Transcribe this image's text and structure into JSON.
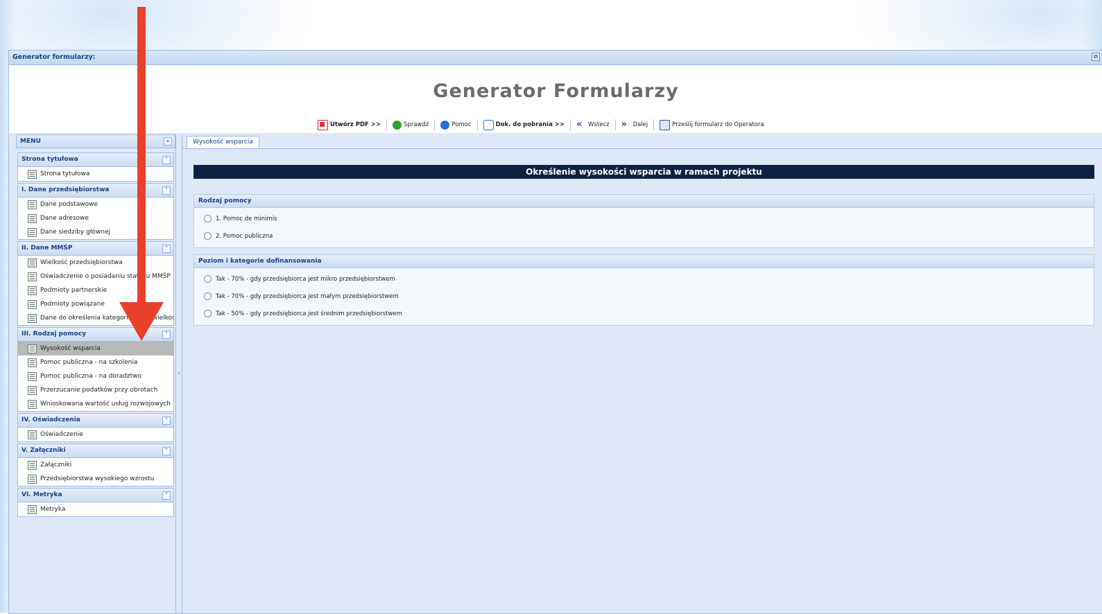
{
  "window": {
    "title": "Generator formularzy:",
    "restore_icon": "restore-icon"
  },
  "header": {
    "heading": "Generator Formularzy"
  },
  "toolbar": {
    "items": [
      {
        "label": "Utwórz PDF >>",
        "icon": "pdf-icon"
      },
      {
        "label": "Sprawdź",
        "icon": "check-icon"
      },
      {
        "label": "Pomoc",
        "icon": "help-icon"
      },
      {
        "label": "Dok. do pobrania >>",
        "icon": "download-icon"
      },
      {
        "label": "Wstecz",
        "icon": "prev-icon"
      },
      {
        "label": "Dalej",
        "icon": "next-icon"
      },
      {
        "label": "Prześlij formularz do Operatora",
        "icon": "send-icon"
      }
    ]
  },
  "menu": {
    "title": "MENU",
    "sections": [
      {
        "label": "Strona tytułowa",
        "items": [
          "Strona tytułowa"
        ]
      },
      {
        "label": "I. Dane przedsiębiorstwa",
        "items": [
          "Dane podstawowe",
          "Dane adresowe",
          "Dane siedziby głównej"
        ]
      },
      {
        "label": "II. Dane MMŚP",
        "items": [
          "Wielkość przedsiębiorstwa",
          "Oświadczenie o posiadaniu statusu MMŚP",
          "Podmioty partnerskie",
          "Podmioty powiązane",
          "Dane do określenia kategorii MMŚP/wielkości"
        ]
      },
      {
        "label": "III. Rodzaj pomocy",
        "items": [
          "Wysokość wsparcia",
          "Pomoc publiczna - na szkolenia",
          "Pomoc publiczna - na doradztwo",
          "Przerzucanie podatków przy obrotach",
          "Wnioskowana wartość usług rozwojowych"
        ]
      },
      {
        "label": "IV. Oświadczenia",
        "items": [
          "Oświadczenie"
        ]
      },
      {
        "label": "V. Załączniki",
        "items": [
          "Załączniki",
          "Przedsiębiorstwa wysokiego wzrostu"
        ]
      },
      {
        "label": "VI. Metryka",
        "items": [
          "Metryka"
        ]
      }
    ],
    "selected": "Wysokość wsparcia"
  },
  "main": {
    "tab": "Wysokość wsparcia",
    "banner": "Określenie wysokości wsparcia w ramach projektu",
    "fieldsets": [
      {
        "title": "Rodzaj pomocy",
        "options": [
          "1. Pomoc de minimis",
          "2. Pomoc publiczna"
        ]
      },
      {
        "title": "Poziom i kategorie dofinansowania",
        "options": [
          "Tak - 70% - gdy przedsiębiorca jest mikro przedsiębiorstwem",
          "Tak - 70% - gdy przedsiębiorca jest małym przedsiębiorstwem",
          "Tak - 50% - gdy przedsiębiorca jest średnim przedsiębiorstwem"
        ]
      }
    ]
  },
  "colors": {
    "annotation_arrow": "#e8402b",
    "banner": "#0d2240",
    "panel_border": "#99bbe8"
  }
}
